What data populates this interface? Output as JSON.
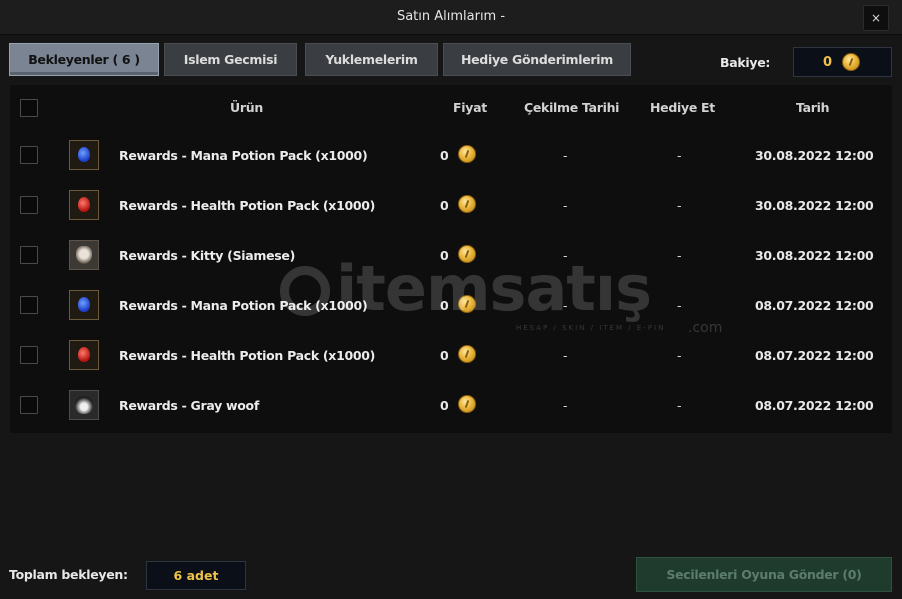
{
  "window": {
    "title": "Satın Alımlarım -",
    "close_label": "×"
  },
  "tabs": [
    {
      "label": "Bekleyenler ( 6 )",
      "active": true
    },
    {
      "label": "Islem Gecmisi",
      "active": false
    },
    {
      "label": "Yuklemelerim",
      "active": false
    },
    {
      "label": "Hediye Gönderimlerim",
      "active": false
    }
  ],
  "balance": {
    "label": "Bakiye:",
    "value": "0",
    "icon": "coin-icon"
  },
  "table": {
    "headers": {
      "product": "Ürün",
      "price": "Fiyat",
      "withdraw_date": "Çekilme Tarihi",
      "gift": "Hediye Et",
      "date": "Tarih"
    },
    "rows": [
      {
        "icon": "mana-potion-icon",
        "name": "Rewards - Mana Potion Pack (x1000)",
        "price": "0",
        "withdraw_date": "-",
        "gift": "-",
        "date": "30.08.2022 12:00"
      },
      {
        "icon": "health-potion-icon",
        "name": "Rewards - Health Potion Pack (x1000)",
        "price": "0",
        "withdraw_date": "-",
        "gift": "-",
        "date": "30.08.2022 12:00"
      },
      {
        "icon": "kitty-icon",
        "name": "Rewards - Kitty (Siamese)",
        "price": "0",
        "withdraw_date": "-",
        "gift": "-",
        "date": "30.08.2022 12:00"
      },
      {
        "icon": "mana-potion-icon",
        "name": "Rewards - Mana Potion Pack (x1000)",
        "price": "0",
        "withdraw_date": "-",
        "gift": "-",
        "date": "08.07.2022 12:00"
      },
      {
        "icon": "health-potion-icon",
        "name": "Rewards - Health Potion Pack (x1000)",
        "price": "0",
        "withdraw_date": "-",
        "gift": "-",
        "date": "08.07.2022 12:00"
      },
      {
        "icon": "gray-woof-icon",
        "name": "Rewards - Gray woof",
        "price": "0",
        "withdraw_date": "-",
        "gift": "-",
        "date": "08.07.2022 12:00"
      }
    ]
  },
  "watermark": {
    "text": "itemsatış",
    "sub": "HESAP / SKIN / ITEM / E-PIN",
    "suffix": ".com"
  },
  "footer": {
    "total_label": "Toplam bekleyen:",
    "total_value": "6 adet",
    "send_button": "Secilenleri Oyuna Gönder (0)"
  },
  "colors": {
    "accent_gold": "#f0c24a",
    "active_tab": "#7a8492",
    "send_button": "#1f3b2d"
  }
}
